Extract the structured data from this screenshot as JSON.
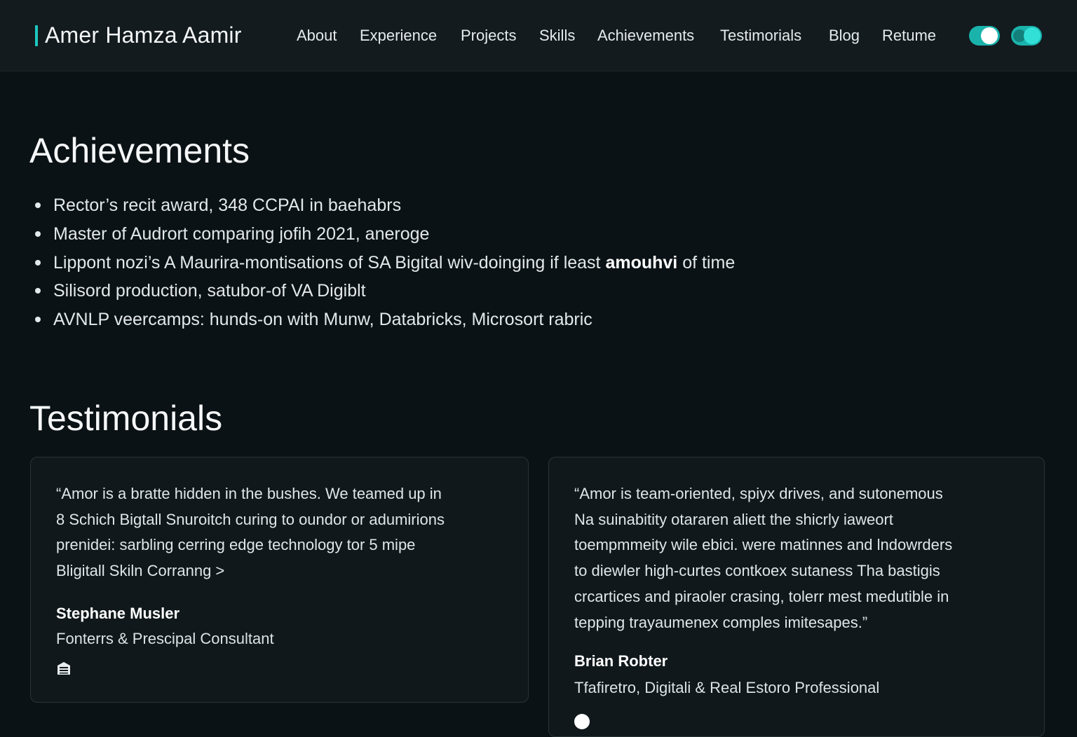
{
  "header": {
    "brand": "Amer Hamza Aamir",
    "nav": [
      {
        "label": "About"
      },
      {
        "label": "Experience"
      },
      {
        "label": "Projects"
      },
      {
        "label": "Skills"
      },
      {
        "label": "Achievements"
      },
      {
        "label": "Testimorials"
      },
      {
        "label": "Blog"
      },
      {
        "label": "Retume"
      }
    ],
    "accent_color": "#1ec8c0"
  },
  "achievements": {
    "title": "Achievements",
    "items": [
      {
        "text": "Rector’s recit award, 348 CCPAI in baehabrs"
      },
      {
        "text": "Master of Audrort comparing jofih  2021, aneroge"
      },
      {
        "text_before": "Lippont nozi’s A Maurira-montisations of SA Bigital wiv-doinging if least ",
        "bold": "amouhvi",
        "text_after": " of time"
      },
      {
        "text": "Silisord production, satubor-of VA Digiblt"
      },
      {
        "text": "AVNLP veercamps: hunds-on with Munw, Databricks, Microsort rabric"
      }
    ]
  },
  "testimonials": {
    "title": "Testimonials",
    "cards": [
      {
        "quote_lines": [
          "“Amor is a bratte hidden in the bushes.  We teamed up in",
          "8 Schich Bigtall Snuroitch curing to oundor or adumirions",
          "prenidei: sarbling cerring edge technology tor 5 mipe",
          "Bligitall Skiln Corranng >"
        ],
        "name": "Stephane Musler",
        "role": "Fonterrs & Prescipal Consultant",
        "icon": "building-icon"
      },
      {
        "quote_lines": [
          "“Amor is team-oriented, spiyx drives, and sutonemous",
          "Na suinabitity otararen aliett the shicrly iaweort",
          "toempmmeity wile ebici. were matinnes and lndowrders",
          "to diewler high-curtes contkoex sutaness  Tha bastigis",
          "crcartices and piraoler crasing, tolerr mest medutible in",
          "tepping trayaumenex comples imitesapes.”"
        ],
        "name": "Brian Robter",
        "role": "Tfafiretro, Digitali & Real Estoro Professional",
        "icon": "dot-icon"
      }
    ]
  }
}
